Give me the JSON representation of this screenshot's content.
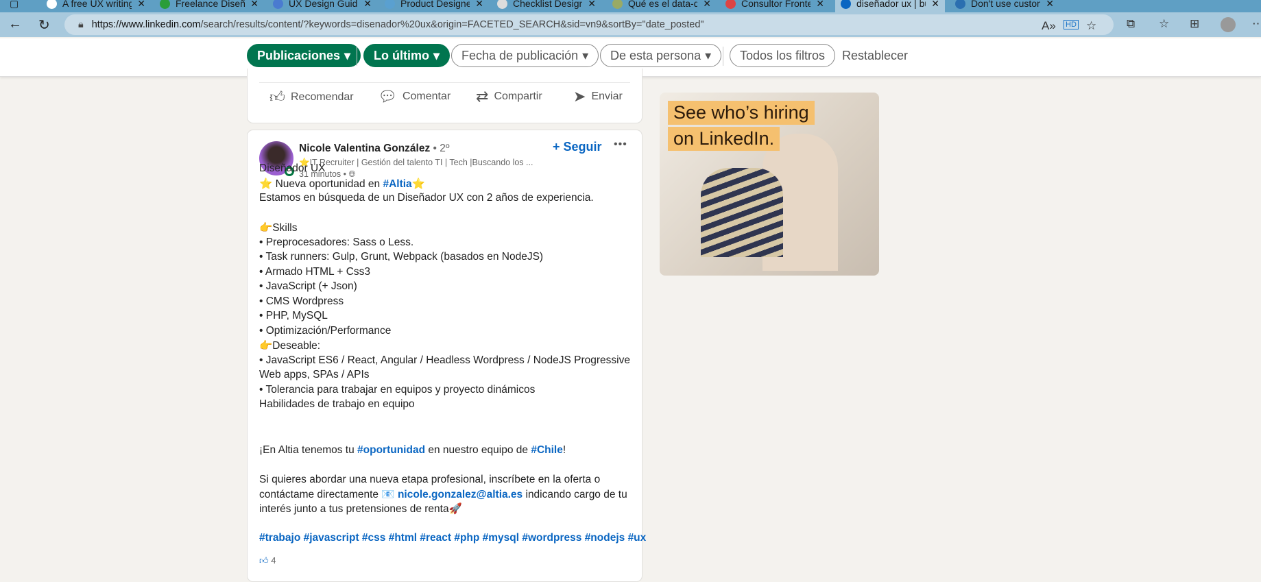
{
  "browser": {
    "tabs": [
      {
        "title": "A free UX writing cour"
      },
      {
        "title": "Freelance Diseñador U"
      },
      {
        "title": "UX Design Guide for S"
      },
      {
        "title": "Product Designer (Ren"
      },
      {
        "title": "Checklist Design - A c"
      },
      {
        "title": "Qué es el data-driven"
      },
      {
        "title": "Consultor Frontend/U"
      },
      {
        "title": "diseñador ux | búsque",
        "active": true
      },
      {
        "title": "Don't use custom CSS"
      }
    ],
    "url_domain": "https://www.linkedin.com",
    "url_path": "/search/results/content/?keywords=disenador%20ux&origin=FACETED_SEARCH&sid=vn9&sortBy=\"date_posted\""
  },
  "filters": {
    "type": "Publicaciones",
    "sort": "Lo último",
    "date": "Fecha de publicación",
    "author": "De esta persona",
    "all": "Todos los filtros",
    "reset": "Restablecer"
  },
  "prev_post_actions": {
    "like": "Recomendar",
    "comment": "Comentar",
    "share": "Compartir",
    "send": "Enviar"
  },
  "post": {
    "author": "Nicole Valentina González",
    "degree": "• 2º",
    "headline": "⭐IT Recruiter | Gestión del talento TI | Tech |Buscando los ...",
    "time": "31 minutos •",
    "follow": "+ Seguir",
    "more": "•••",
    "lines": [
      "Diseñador UX",
      "⭐ Nueva oportunidad en ",
      "Estamos en búsqueda de un Diseñador UX con 2 años de experiencia.",
      "",
      "👉Skills",
      "•    Preprocesadores: Sass o Less.",
      "•    Task runners: Gulp, Grunt, Webpack (basados en NodeJS)",
      "•    Armado HTML + Css3",
      "•    JavaScript (+ Json)",
      "•    CMS Wordpress",
      "•    PHP, MySQL",
      "•    Optimización/Performance",
      "👉Deseable:",
      "•    JavaScript ES6 / React, Angular / Headless Wordpress / NodeJS Progressive",
      "Web apps, SPAs / APIs",
      "•    Tolerancia para trabajar en equipos y proyecto dinámicos",
      "Habilidades de trabajo en equipo"
    ],
    "altia_tag": "#Altia",
    "chile_p1": "¡En Altia tenemos tu ",
    "chile_tag1": "#oportunidad",
    "chile_p2": " en nuestro equipo de ",
    "chile_tag2": "#Chile",
    "chile_p3": "!",
    "contact1": "Si quieres abordar una nueva etapa profesional, inscríbete en la oferta o",
    "contact2a": "contáctame directamente 📧 ",
    "email": "nicole.gonzalez@altia.es",
    "contact2b": " indicando cargo de tu",
    "contact3": "interés junto a tus pretensiones de renta🚀",
    "hashtags": "#trabajo #javascript #css #html #react #php #mysql #wordpress #nodejs #ux",
    "reactions": "4"
  },
  "ad": {
    "line1": "See who’s hiring",
    "line2": "on LinkedIn."
  }
}
